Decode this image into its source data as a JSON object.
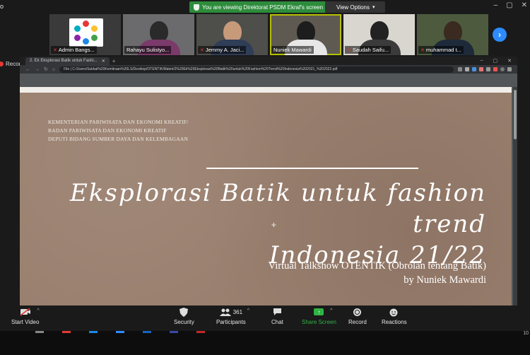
{
  "top_bar": {
    "left_text": "o",
    "banner": "You are viewing Direktorat PSDM Ekraf's screen",
    "view_options": "View Options"
  },
  "participants": [
    {
      "name": "Admin Bangs..."
    },
    {
      "name": "Rahayu Sulistyo..."
    },
    {
      "name": "Jemmy A. Jaci..."
    },
    {
      "name": "Nuniek Mawardi"
    },
    {
      "name": "Saudah Saifu..."
    },
    {
      "name": "muhammad t..."
    }
  ],
  "recording_label": "Recording",
  "browser": {
    "tab_title": "2. Ek Eksplorasi Batik untuk Fashi...",
    "address": "File | C:/Users/Sukbal%20Kemitraan%20LS/Desktop/OTENTIK/Materi/2%20Ek%20Eksplorasi%20Batik%20untuk%20Fashion%20Trend%20Indonesia%202021_%202022.pdf"
  },
  "slide": {
    "institution": [
      "KEMENTERIAN PARIWISATA DAN EKONOMI KREATIF/",
      "BADAN PARIWISATA DAN EKONOMI KREATIF",
      "DEPUTI BIDANG SUMBER DAYA DAN KELEMBAGAAN"
    ],
    "title_line1": "Eksplorasi Batik untuk fashion trend",
    "title_line2": "Indonesia 21/22",
    "subtitle_line1": "Virtual Talkshow OTENTIK (Obrolan tentang Batik)",
    "subtitle_line2": "by Nuniek Mawardi"
  },
  "toolbar": {
    "start_video": "Start Video",
    "security": "Security",
    "participants": "Participants",
    "participants_count": "361",
    "chat": "Chat",
    "share_screen": "Share Screen",
    "record": "Record",
    "reactions": "Reactions"
  },
  "taskbar": {
    "clock_partial": "10"
  },
  "colors": {
    "banner_green": "#2d8c3c",
    "share_green": "#2fb344",
    "active_outline": "#b5c000",
    "next_blue": "#2d8cff",
    "slide_bg": "#9a806f"
  }
}
